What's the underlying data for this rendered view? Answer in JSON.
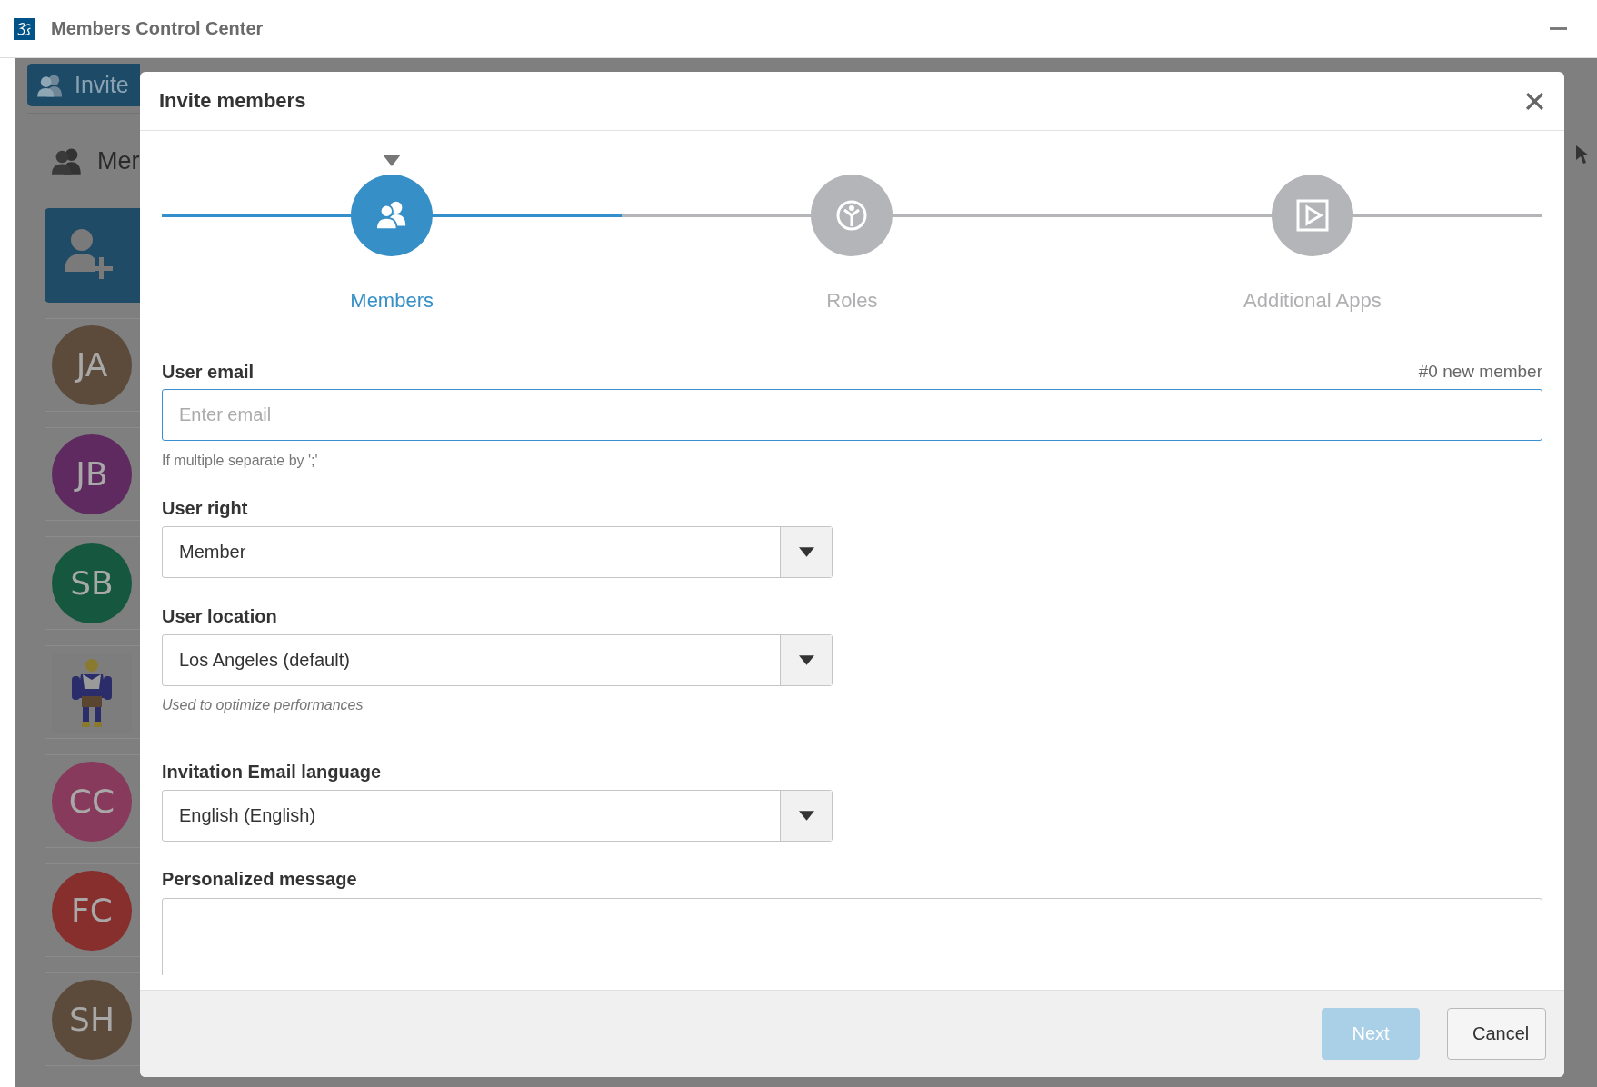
{
  "window": {
    "title": "Members Control Center"
  },
  "background": {
    "invite_button": "Invite",
    "section_title": "Mer",
    "members": [
      {
        "kind": "initials",
        "initials": "JA",
        "color": "#5c4a3a"
      },
      {
        "kind": "initials",
        "initials": "JB",
        "color": "#5e2a60"
      },
      {
        "kind": "initials",
        "initials": "SB",
        "color": "#15583f"
      },
      {
        "kind": "picture"
      },
      {
        "kind": "initials",
        "initials": "CC",
        "color": "#883a5c"
      },
      {
        "kind": "initials",
        "initials": "FC",
        "color": "#862f2c"
      },
      {
        "kind": "initials",
        "initials": "SH",
        "color": "#5c4a3a"
      }
    ]
  },
  "dialog": {
    "title": "Invite members",
    "steps": [
      {
        "label": "Members",
        "selected": true,
        "kind": "members"
      },
      {
        "label": "Roles",
        "selected": false,
        "kind": "roles"
      },
      {
        "label": "Additional Apps",
        "selected": false,
        "kind": "apps"
      }
    ],
    "email": {
      "label": "User email",
      "counter": "#0 new member",
      "placeholder": "Enter email",
      "hint": "If multiple separate by ';'"
    },
    "user_right": {
      "label": "User right",
      "value": "Member"
    },
    "user_location": {
      "label": "User location",
      "value": "Los Angeles (default)",
      "hint": "Used to optimize performances"
    },
    "language": {
      "label": "Invitation Email language",
      "value": "English (English)"
    },
    "message": {
      "label": "Personalized message"
    },
    "buttons": [
      {
        "label": "Next",
        "kind": "primary",
        "disabled": true
      },
      {
        "label": "Cancel",
        "kind": "secondary",
        "disabled": false
      }
    ]
  }
}
